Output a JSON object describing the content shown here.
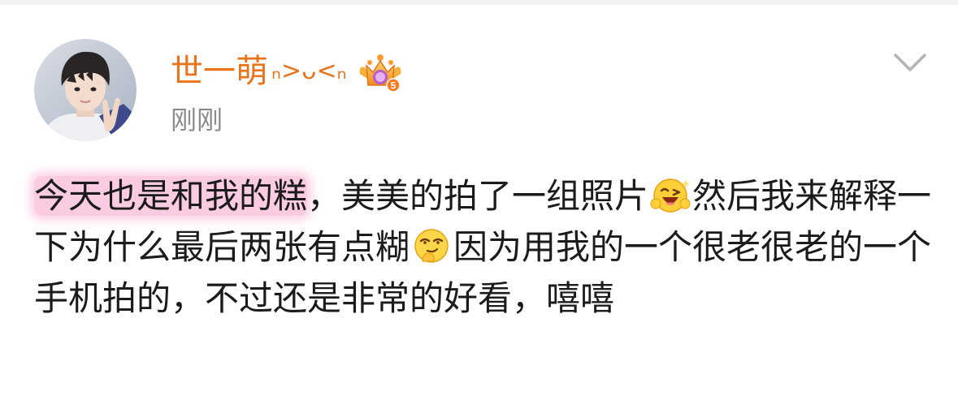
{
  "post": {
    "username": "世一萌",
    "kaomoji": "ₙ>ᴗ<ₙ",
    "timestamp": "刚刚",
    "body": {
      "highlighted": "今天也是和我的糕",
      "part1": "，美美的拍了一组照片",
      "part2": "然后我来解释一下为什么最后两张有点糊",
      "part3": "因为用我的一个很老很老的一个手机拍的，不过还是非常的好看，嘻嘻"
    },
    "emoji_1": "grinning-wink-emoji",
    "emoji_2": "thinking-sly-emoji"
  },
  "icons": {
    "vip_badge": "crown-badge-icon",
    "vip_badge_level": "5",
    "menu": "chevron-down-icon"
  },
  "colors": {
    "username": "#e8751e",
    "timestamp": "#8a8a8a",
    "body_text": "#1b1b1b",
    "highlight": "#f9b9d7",
    "chevron": "#b3b3b3"
  }
}
